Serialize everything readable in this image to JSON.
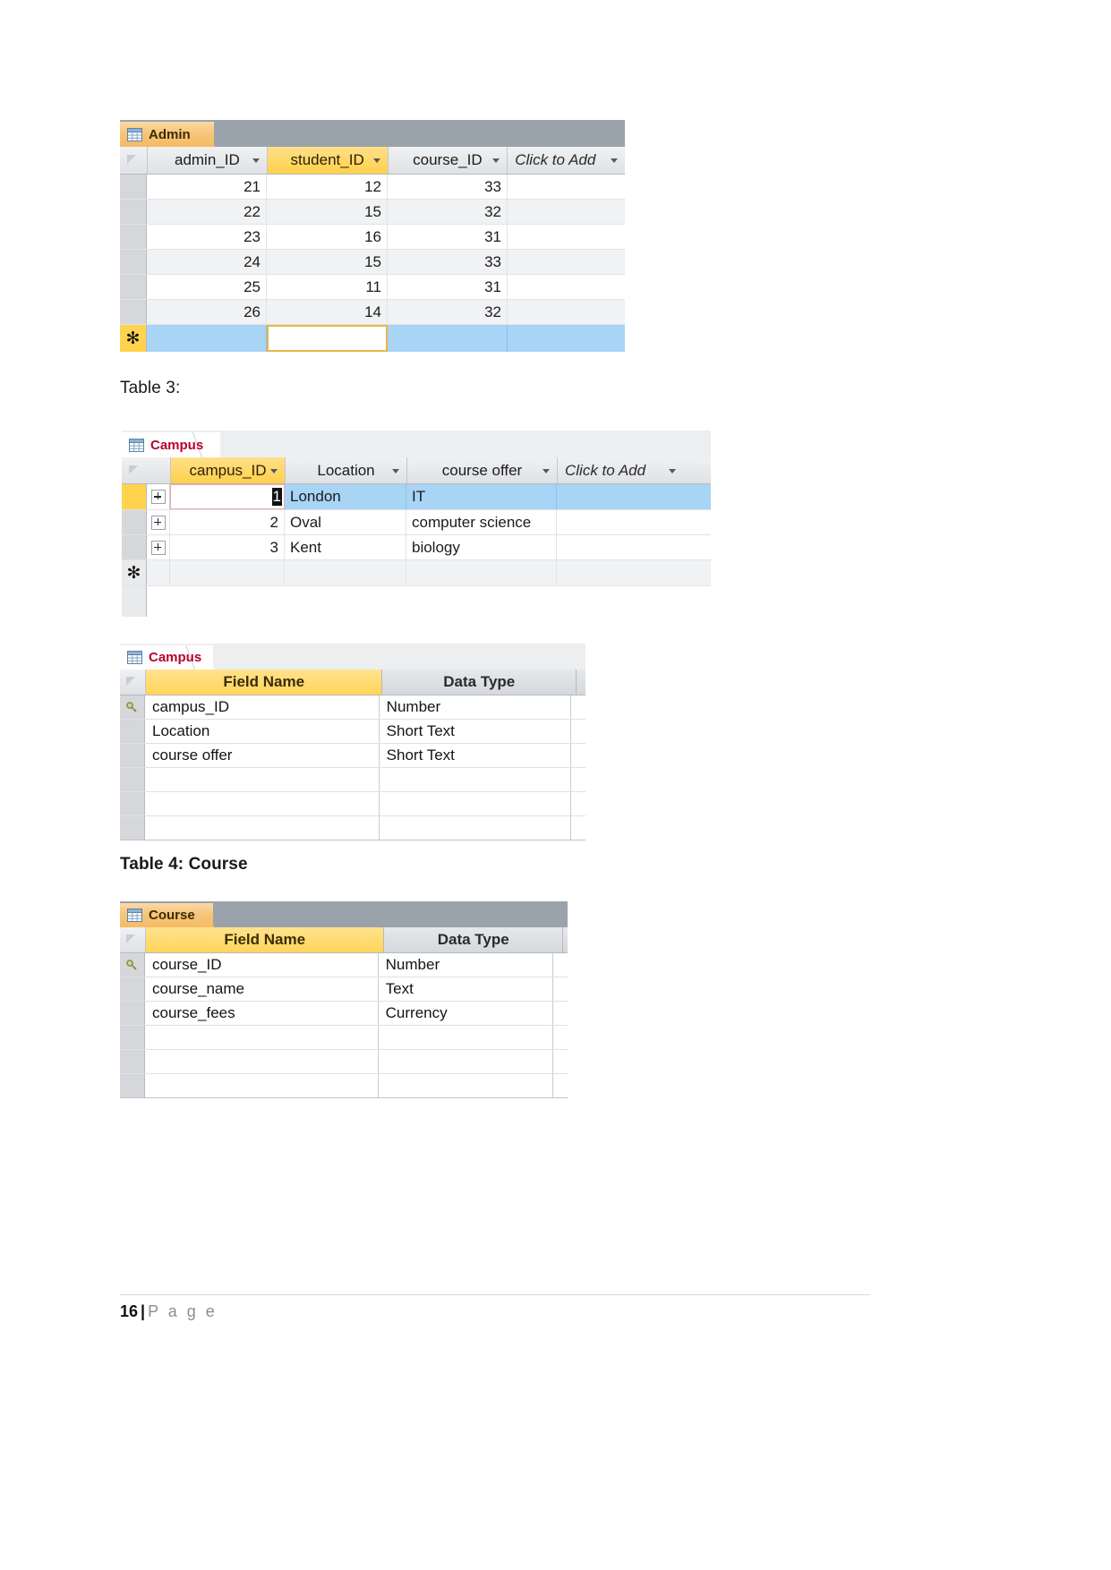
{
  "page": {
    "footer_number": "16",
    "footer_separator": "|",
    "footer_word": "P a g e"
  },
  "captions": {
    "table3": "Table 3:",
    "table4": "Table 4: Course"
  },
  "admin_datasheet": {
    "tab_label": "Admin",
    "tab_icon": "table-icon",
    "columns": [
      {
        "label": "admin_ID",
        "active": false
      },
      {
        "label": "student_ID",
        "active": true
      },
      {
        "label": "course_ID",
        "active": false
      },
      {
        "label": "Click to Add",
        "active": false
      }
    ],
    "rows": [
      {
        "admin_ID": "21",
        "student_ID": "12",
        "course_ID": "33"
      },
      {
        "admin_ID": "22",
        "student_ID": "15",
        "course_ID": "32"
      },
      {
        "admin_ID": "23",
        "student_ID": "16",
        "course_ID": "31"
      },
      {
        "admin_ID": "24",
        "student_ID": "15",
        "course_ID": "33"
      },
      {
        "admin_ID": "25",
        "student_ID": "11",
        "course_ID": "31"
      },
      {
        "admin_ID": "26",
        "student_ID": "14",
        "course_ID": "32"
      }
    ],
    "new_record_marker": "✻",
    "new_record_active_column": "student_ID"
  },
  "campus_datasheet": {
    "tab_label": "Campus",
    "tab_icon": "table-icon",
    "columns": [
      {
        "label": "campus_ID",
        "active": true
      },
      {
        "label": "Location",
        "active": false
      },
      {
        "label": "course offer",
        "active": false
      },
      {
        "label": "Click to Add",
        "active": false
      }
    ],
    "rows": [
      {
        "campus_ID": "1",
        "Location": "London",
        "course_offer": "IT",
        "selected": true,
        "editing": true
      },
      {
        "campus_ID": "2",
        "Location": "Oval",
        "course_offer": "computer science",
        "selected": false,
        "editing": false
      },
      {
        "campus_ID": "3",
        "Location": "Kent",
        "course_offer": "biology",
        "selected": false,
        "editing": false
      }
    ],
    "new_record_marker": "✻"
  },
  "campus_design": {
    "tab_label": "Campus",
    "tab_icon": "table-icon",
    "columns": {
      "field_name": "Field Name",
      "data_type": "Data Type"
    },
    "rows": [
      {
        "field_name": "campus_ID",
        "data_type": "Number",
        "primary_key": true
      },
      {
        "field_name": "Location",
        "data_type": "Short Text",
        "primary_key": false
      },
      {
        "field_name": "course offer",
        "data_type": "Short Text",
        "primary_key": false
      },
      {
        "field_name": "",
        "data_type": "",
        "primary_key": false
      },
      {
        "field_name": "",
        "data_type": "",
        "primary_key": false
      },
      {
        "field_name": "",
        "data_type": "",
        "primary_key": false
      }
    ]
  },
  "course_design": {
    "tab_label": "Course",
    "tab_icon": "table-icon",
    "columns": {
      "field_name": "Field Name",
      "data_type": "Data Type"
    },
    "rows": [
      {
        "field_name": "course_ID",
        "data_type": "Number",
        "primary_key": true
      },
      {
        "field_name": "course_name",
        "data_type": "Text",
        "primary_key": false
      },
      {
        "field_name": "course_fees",
        "data_type": "Currency",
        "primary_key": false
      },
      {
        "field_name": "",
        "data_type": "",
        "primary_key": false
      },
      {
        "field_name": "",
        "data_type": "",
        "primary_key": false
      },
      {
        "field_name": "",
        "data_type": "",
        "primary_key": false
      }
    ]
  },
  "colors": {
    "tab_active": "#f5bb63",
    "tab_inactive_text": "#b8002e",
    "header_active": "#ffd04a",
    "row_selected": "#a8d4f5",
    "new_record_marker_bg": "#ffd34d",
    "edit_border": "#e9b54a",
    "edit_border_pink": "#f1a8b0"
  }
}
